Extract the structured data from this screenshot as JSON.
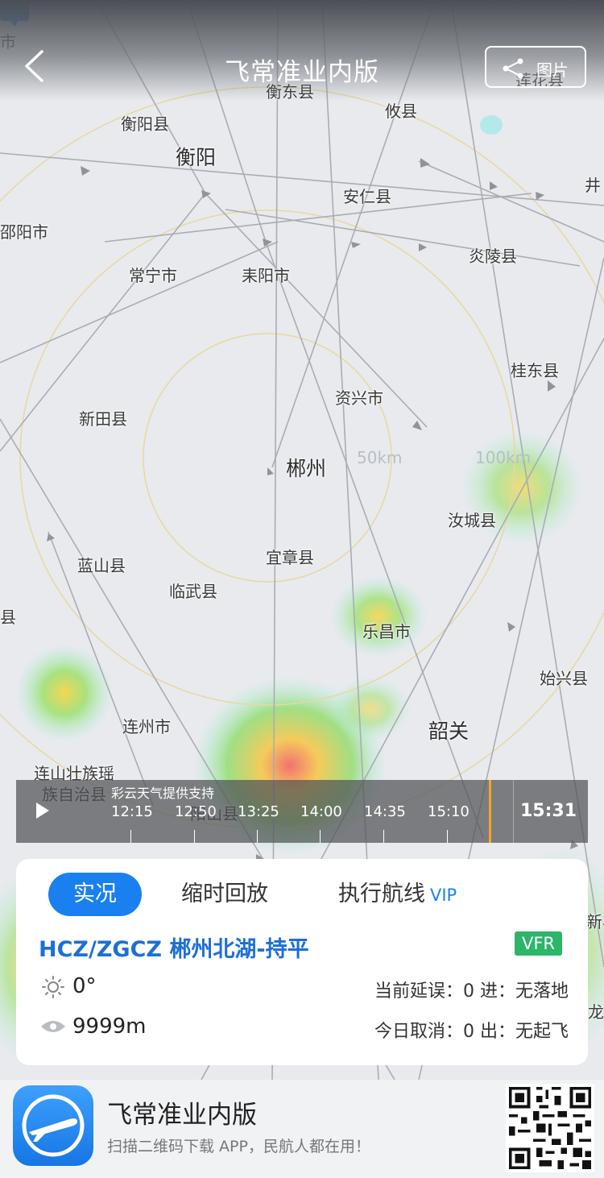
{
  "header": {
    "title": "飞常准业内版",
    "image_button_label": "图片"
  },
  "map": {
    "cities": [
      {
        "name": "衡东县",
        "big": false
      },
      {
        "name": "攸县",
        "big": false
      },
      {
        "name": "莲花县",
        "big": false
      },
      {
        "name": "衡阳县",
        "big": false
      },
      {
        "name": "衡阳",
        "big": true
      },
      {
        "name": "安仁县",
        "big": false
      },
      {
        "name": "井",
        "big": false
      },
      {
        "name": "邵阳市",
        "big": false
      },
      {
        "name": "炎陵县",
        "big": false
      },
      {
        "name": "常宁市",
        "big": false
      },
      {
        "name": "耒阳市",
        "big": false
      },
      {
        "name": "桂东县",
        "big": false
      },
      {
        "name": "资兴市",
        "big": false
      },
      {
        "name": "新田县",
        "big": false
      },
      {
        "name": "郴州",
        "big": true
      },
      {
        "name": "汝城县",
        "big": false
      },
      {
        "name": "宜章县",
        "big": false
      },
      {
        "name": "蓝山县",
        "big": false
      },
      {
        "name": "临武县",
        "big": false
      },
      {
        "name": "县",
        "big": false
      },
      {
        "name": "乐昌市",
        "big": false
      },
      {
        "name": "始兴县",
        "big": false
      },
      {
        "name": "连州市",
        "big": false
      },
      {
        "name": "韶关",
        "big": true
      },
      {
        "name": "连山壮族瑶",
        "big": false
      },
      {
        "name": "族自治县",
        "big": false
      },
      {
        "name": "阳山县",
        "big": false
      },
      {
        "name": "市",
        "big": false
      },
      {
        "name": "新丰",
        "big": false
      },
      {
        "name": "龙",
        "big": false
      }
    ],
    "ring_labels": [
      "50km",
      "100km"
    ]
  },
  "timeline": {
    "source_note": "彩云天气提供支持",
    "times": [
      "12:15",
      "12:50",
      "13:25",
      "14:00",
      "14:35",
      "15:10"
    ],
    "current_time": "15:31"
  },
  "card": {
    "tabs": [
      {
        "label": "实况",
        "active": true
      },
      {
        "label": "缩时回放",
        "active": false
      },
      {
        "label": "执行航线",
        "badge": "VIP",
        "active": false
      }
    ],
    "station": "HCZ/ZGCZ 郴州北湖-持平",
    "flight_rule": "VFR",
    "temperature": "0°",
    "visibility": "9999m",
    "delay": "当前延误：0 进：无落地",
    "cancel": "今日取消：0 出：无起飞"
  },
  "banner": {
    "app_name": "飞常准业内版",
    "subtitle": "扫描二维码下载 APP，民航人都在用！"
  },
  "colors": {
    "accent": "#1a80f0",
    "vfr": "#2db56a",
    "timeline_marker": "#f5a623"
  }
}
